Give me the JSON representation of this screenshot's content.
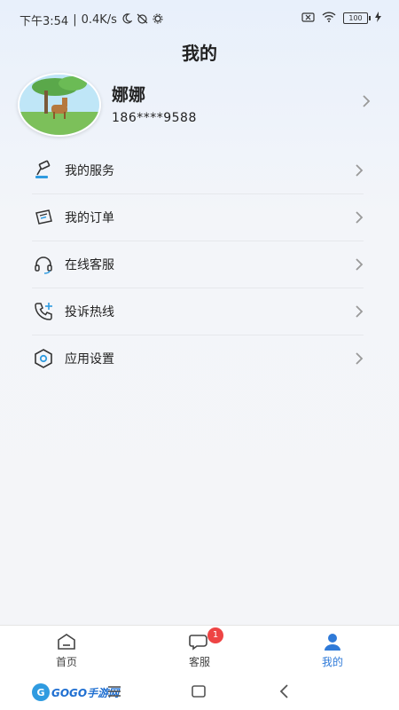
{
  "status": {
    "time": "下午3:54",
    "speed": "0.4K/s",
    "battery": "100"
  },
  "header": {
    "title": "我的"
  },
  "profile": {
    "name": "娜娜",
    "phone": "186****9588"
  },
  "menu": {
    "items": [
      {
        "label": "我的服务",
        "icon": "service-icon"
      },
      {
        "label": "我的订单",
        "icon": "order-icon"
      },
      {
        "label": "在线客服",
        "icon": "headset-icon"
      },
      {
        "label": "投诉热线",
        "icon": "phone-icon"
      },
      {
        "label": "应用设置",
        "icon": "settings-icon"
      }
    ]
  },
  "tabbar": {
    "tabs": [
      {
        "label": "首页",
        "icon": "home-icon"
      },
      {
        "label": "客服",
        "icon": "chat-icon",
        "badge": "1"
      },
      {
        "label": "我的",
        "icon": "user-icon",
        "active": true
      }
    ],
    "active_color": "#2f7ad8"
  },
  "navbar": {
    "watermark": "GOGO手游网"
  }
}
